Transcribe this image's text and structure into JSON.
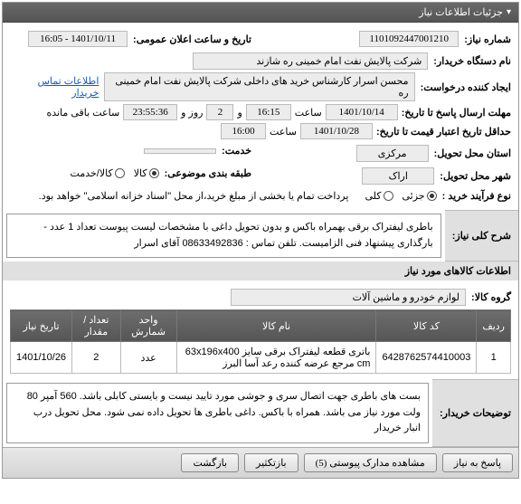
{
  "main_header": "جزئیات اطلاعات نیاز",
  "fields": {
    "need_no_label": "شماره نیاز:",
    "need_no": "1101092447001210",
    "announce_label": "تاریخ و ساعت اعلان عمومی:",
    "announce_val": "1401/10/11 - 16:05",
    "org_label": "نام دستگاه خریدار:",
    "org_val": "شرکت پالایش نفت امام خمینی  ره  شازند",
    "creator_label": "ایجاد کننده درخواست:",
    "creator_val": "محسن  اسرار کارشناس خرید های داخلی  شرکت پالایش نفت امام خمینی  ره",
    "contact_link": "اطلاعات تماس خریدار",
    "deadline_label": "مهلت ارسال پاسخ تا تاریخ:",
    "deadline_date": "1401/10/14",
    "hour_lbl": "ساعت",
    "deadline_time": "16:15",
    "and_lbl": "و",
    "day_lbl": "روز و",
    "days_left": "2",
    "time_left": "23:55:36",
    "time_left_suffix": "ساعت باقی مانده",
    "credit_deadline_label": "حداقل تاریخ اعتبار قیمت تا تاریخ:",
    "credit_date": "1401/10/28",
    "credit_time": "16:00",
    "province_label": "استان محل تحویل:",
    "province_val": "مرکزی",
    "service_label": "خدمت:",
    "city_label": "شهر محل تحویل:",
    "city_val": "اراک",
    "budget_label": "طبقه بندی موضوعی:",
    "is_goods": "کالا",
    "is_service": "کالا/خدمت",
    "buy_type_label": "نوع فرآیند خرید :",
    "buy_partial": "جزئی",
    "buy_full": "کلی",
    "payment_note": "پرداخت تمام یا بخشی از مبلغ خرید،از محل \"اسناد خزانه اسلامی\" خواهد بود.",
    "desc_label": "شرح کلی نیاز:",
    "desc_text": "باطری لیفتراک برقی بهمراه باکس و بدون تحویل داغی با مشخصات لیست پیوست تعداد 1 عدد - بارگذاری پیشنهاد فنی الزامیست.  تلفن تماس : 08633492836 آقای اسرار",
    "goods_header": "اطلاعات کالاهای مورد نیاز",
    "group_label": "گروه کالا:",
    "group_val": "لوازم خودرو و ماشین آلات",
    "explain_label": "توضیحات خریدار:",
    "explain_text": "بست های باطری جهت اتصال سری و جوشی مورد تایید نیست و بایستی کابلی باشد. 560 آمپر 80 ولت مورد نیاز می باشد. همراه با باکس. داغی باطری ها تحویل داده نمی شود. محل تحویل درب انبار خریدار"
  },
  "table": {
    "headers": {
      "row": "ردیف",
      "code": "کد کالا",
      "name": "نام کالا",
      "unit": "واحد شمارش",
      "qty": "تعداد / مقدار",
      "date": "تاریخ نیاز"
    },
    "rows": [
      {
        "row": "1",
        "code": "6428762574410003",
        "name": "باتری قطعه لیفتراک برقی سایز 63x196x400 cm مرجع عرضه کننده رعد آسا البرز",
        "unit": "عدد",
        "qty": "2",
        "date": "1401/10/26"
      }
    ]
  },
  "footer": {
    "reply": "پاسخ به نیاز",
    "attach": "مشاهده مدارک پیوستی (5)",
    "print": "بازتکثیر",
    "back": "بازگشت"
  }
}
